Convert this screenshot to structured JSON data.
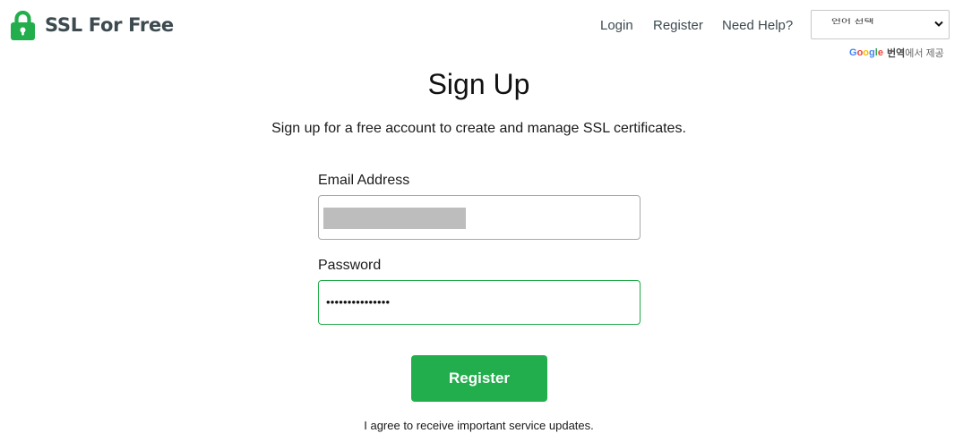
{
  "header": {
    "brand": "SSL For Free",
    "nav": {
      "login": "Login",
      "register": "Register",
      "help": "Need Help?"
    },
    "language_select": {
      "selected": "언어 선택"
    },
    "translate_credit": {
      "google": [
        "G",
        "o",
        "o",
        "g",
        "l",
        "e"
      ],
      "link": "번역",
      "rest": "에서 제공"
    }
  },
  "main": {
    "title": "Sign Up",
    "subtitle": "Sign up for a free account to create and manage SSL certificates.",
    "form": {
      "email_label": "Email Address",
      "password_label": "Password",
      "password_masked": "•••••••••••••••",
      "submit_label": "Register",
      "agree_text": "I agree to receive important service updates."
    }
  },
  "colors": {
    "brand_green": "#22ae4c",
    "logo_text": "#3d4b50",
    "focus_border": "#22a94a"
  },
  "icons": {
    "logo": "padlock-icon",
    "select_arrow": "chevron-down-icon"
  }
}
